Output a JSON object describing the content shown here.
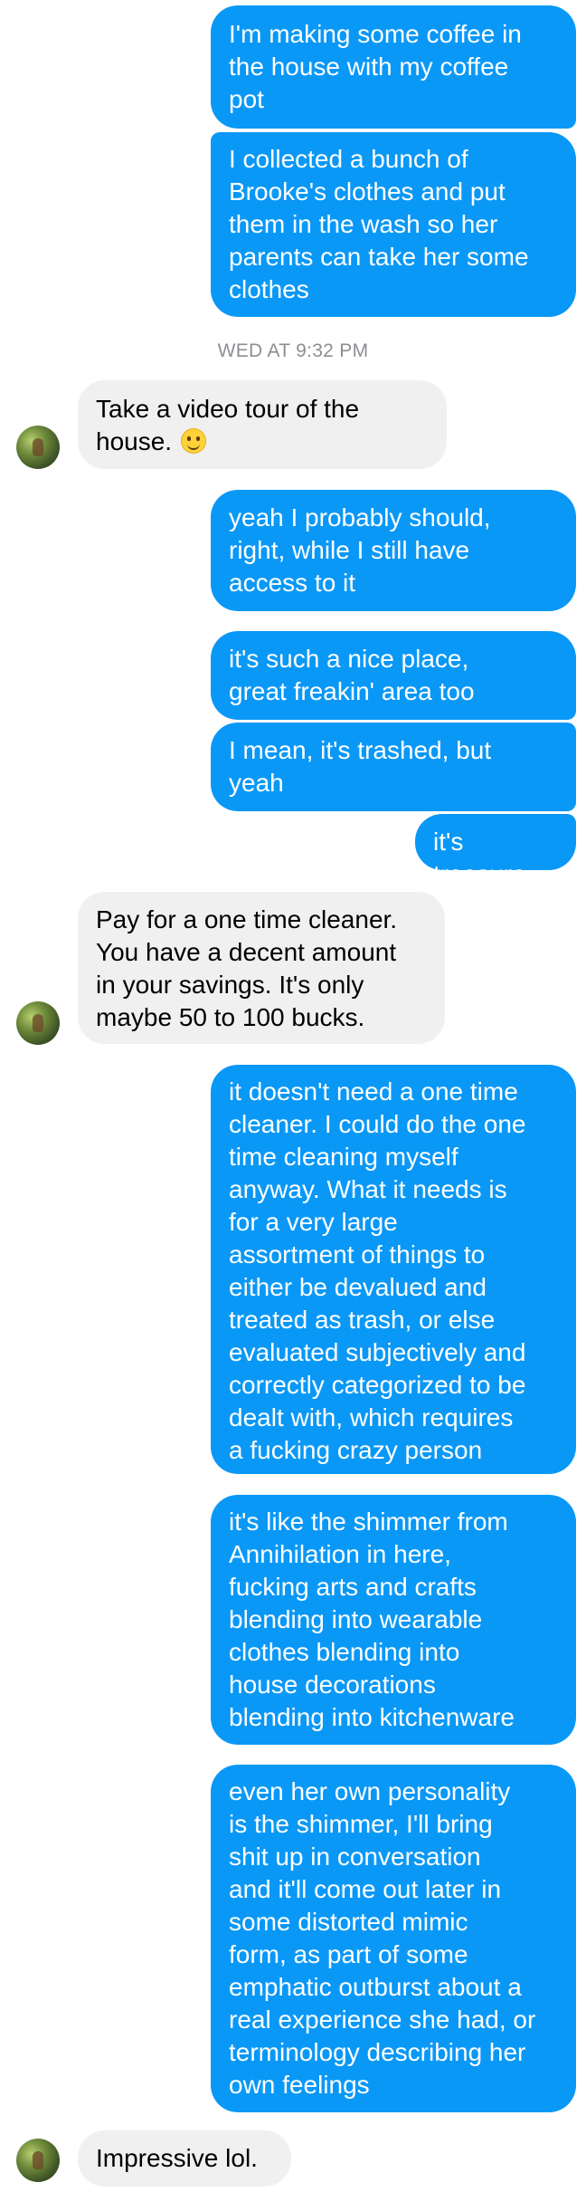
{
  "messages": [
    {
      "text": "I'm making some coffee in\nthe house with my coffee\npot"
    },
    {
      "text": "I collected a bunch of\nBrooke's clothes and put\nthem in the wash so her\nparents can take her some\nclothes"
    },
    {
      "timestamp": "WED AT 9:32 PM"
    },
    {
      "text": "Take a video tour of the\nhouse.",
      "emoji": "slightly-smiling-face"
    },
    {
      "text": "yeah I probably should,\nright, while I still have\naccess to it"
    },
    {
      "text": "it's such a nice place,\ngreat freakin' area too"
    },
    {
      "text": "I mean, it's trashed, but\nyeah"
    },
    {
      "text": "it's treasure"
    },
    {
      "text": "Pay for a one time cleaner.\nYou have a decent amount\nin your savings. It's only\nmaybe 50 to 100 bucks."
    },
    {
      "text": "it doesn't need a one time\ncleaner. I could do the one\ntime cleaning myself\nanyway. What it needs is\nfor a very large\nassortment of things to\neither be devalued and\ntreated as trash, or else\nevaluated subjectively and\ncorrectly categorized to be\ndealt with, which requires\na fucking crazy person"
    },
    {
      "text": "it's like the shimmer from\nAnnihilation in here,\nfucking arts and crafts\nblending into wearable\nclothes blending into\nhouse decorations\nblending into kitchenware"
    },
    {
      "text": "even her own personality\nis the shimmer, I'll bring\nshit up in conversation\nand it'll come out later in\nsome distorted mimic\nform, as part of some\nemphatic outburst about a\nreal experience she had, or\nterminology describing her\nown feelings"
    },
    {
      "text": "Impressive lol."
    }
  ],
  "colors": {
    "sent_bubble": "#0a98f7",
    "received_bubble": "#f0f0f0",
    "timestamp": "#8e8e93"
  }
}
